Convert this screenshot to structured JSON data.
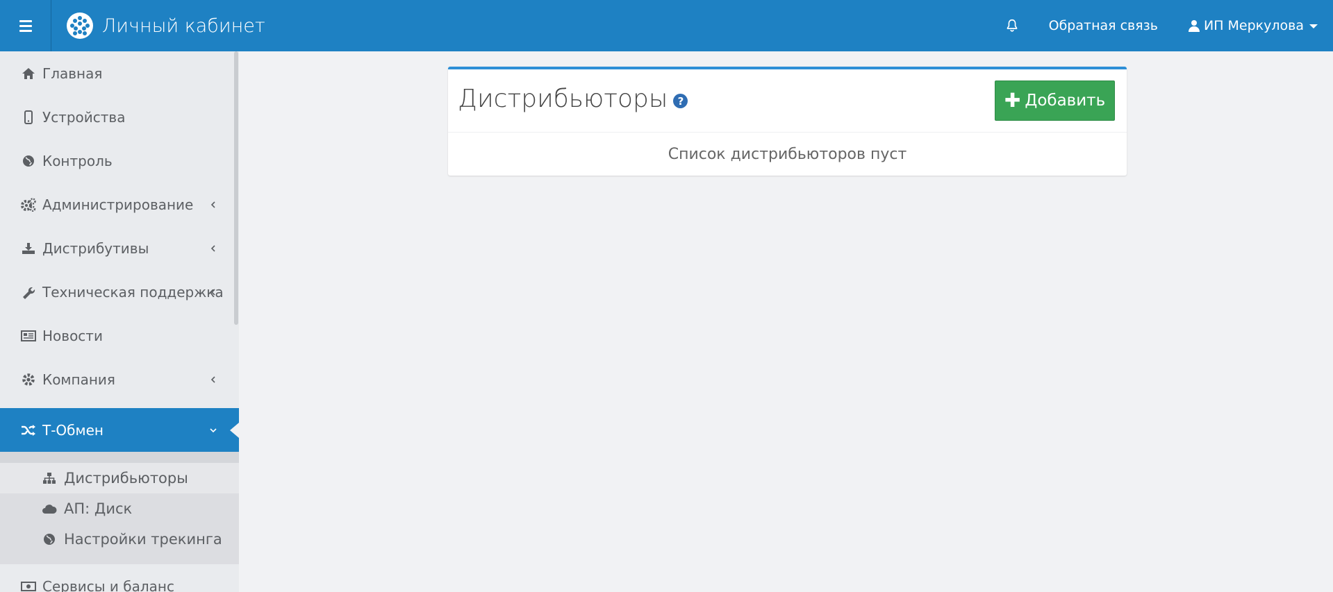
{
  "header": {
    "title": "Личный кабинет",
    "feedback": "Обратная связь",
    "user": "ИП Меркулова",
    "brand_color": "#1e81c3"
  },
  "sidebar": {
    "items": [
      {
        "label": "Главная",
        "icon": "home-icon"
      },
      {
        "label": "Устройства",
        "icon": "mobile-icon"
      },
      {
        "label": "Контроль",
        "icon": "globe-icon"
      },
      {
        "label": "Администрирование",
        "icon": "cogs-icon",
        "expandable": true
      },
      {
        "label": "Дистрибутивы",
        "icon": "download-icon",
        "expandable": true
      },
      {
        "label": "Техническая поддержка",
        "icon": "wrench-icon",
        "expandable": true
      },
      {
        "label": "Новости",
        "icon": "newspaper-icon"
      },
      {
        "label": "Компания",
        "icon": "gear-icon",
        "expandable": true
      },
      {
        "label": "Т-Обмен",
        "icon": "random-icon",
        "expandable": true,
        "active": true
      },
      {
        "label": "Сервисы и баланс",
        "icon": "money-icon"
      }
    ],
    "submenu": [
      {
        "label": "Дистрибьюторы",
        "icon": "sitemap-icon",
        "current": true
      },
      {
        "label": "АП: Диск",
        "icon": "cloud-icon"
      },
      {
        "label": "Настройки трекинга",
        "icon": "globe-icon"
      }
    ]
  },
  "main": {
    "title": "Дистрибьюторы",
    "help": "?",
    "add_button": "Добавить",
    "empty_message": "Список дистрибьюторов пуст",
    "accent_color": "#2d8fd6",
    "button_color": "#3aa455"
  }
}
